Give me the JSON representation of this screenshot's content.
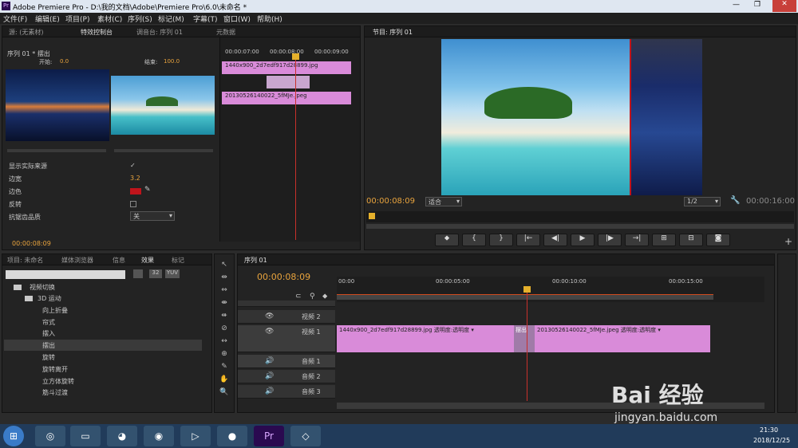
{
  "window": {
    "title": "Adobe Premiere Pro - D:\\我的文档\\Adobe\\Premiere Pro\\6.0\\未命名 *",
    "controls": [
      "—",
      "❐",
      "✕"
    ]
  },
  "menu": [
    "文件(F)",
    "编辑(E)",
    "项目(P)",
    "素材(C)",
    "序列(S)",
    "标记(M)",
    "字幕(T)",
    "窗口(W)",
    "帮助(H)"
  ],
  "source_panel": {
    "tabs": [
      "源: (无素材)",
      "特效控制台",
      "调音台: 序列 01",
      "元数据"
    ],
    "header": "序列 01 * 摆出",
    "start_label": "开始:",
    "start_value": "0.0",
    "end_label": "结束:",
    "end_value": "100.0",
    "timeline_ticks": [
      "00:00:07:00",
      "00:00:08:00",
      "00:00:09:00"
    ],
    "clip_a": "1440x900_2d7edf917d28899.jpg",
    "clip_b": "20130526140022_5fMJe.jpeg",
    "props": [
      {
        "label": "显示实际来源",
        "value": "✓"
      },
      {
        "label": "边宽",
        "value": "3.2"
      },
      {
        "label": "边色",
        "value": ""
      },
      {
        "label": "反转",
        "value": ""
      },
      {
        "label": "抗锯齿品质",
        "value": "关"
      }
    ],
    "timecode": "00:00:08:09"
  },
  "program_panel": {
    "tab": "节目: 序列 01",
    "timecode": "00:00:08:09",
    "fit": "适合",
    "ratio": "1/2",
    "duration": "00:00:16:00",
    "controls": [
      "⬥",
      "{",
      "}",
      "|←",
      "◀|",
      "▶",
      "|▶",
      "→|",
      "⊞",
      "⊟",
      "◙"
    ],
    "add": "+"
  },
  "project_panel": {
    "tabs": [
      "项目: 未命名",
      "媒体浏览器",
      "信息",
      "效果",
      "标记"
    ],
    "search_placeholder": "",
    "toolbar": [
      "32",
      "YUV"
    ],
    "tree": {
      "root": "视频切换",
      "group": "3D 运动",
      "items": [
        "向上折叠",
        "帘式",
        "摆入",
        "摆出",
        "旋转",
        "旋转离开",
        "立方体旋转",
        "筋斗过渡"
      ]
    }
  },
  "tools": [
    "↖",
    "⇹",
    "⇔",
    "⇼",
    "⇺",
    "⊘",
    "↔",
    "⊕",
    "✎",
    "✋",
    "🔍"
  ],
  "timeline": {
    "tab": "序列 01",
    "timecode": "00:00:08:09",
    "ruler": [
      "00:00",
      "00:00:05:00",
      "00:00:10:00",
      "00:00:15:00"
    ],
    "tracks": [
      {
        "name": "视频 3"
      },
      {
        "name": "视频 2"
      },
      {
        "name": "视频 1"
      },
      {
        "name": "音频 1"
      },
      {
        "name": "音频 2"
      },
      {
        "name": "音频 3"
      }
    ],
    "clip1": "1440x900_2d7edf917d28899.jpg",
    "clip1_fx": "透明度:透明度 ▾",
    "transition": "摆出",
    "clip2": "20130526140022_5fMJe.jpeg",
    "clip2_fx": "透明度:透明度 ▾"
  },
  "taskbar": {
    "time": "21:30",
    "date": "2018/12/25"
  },
  "watermark": {
    "brand": "Bai 经验",
    "url": "jingyan.baidu.com"
  }
}
